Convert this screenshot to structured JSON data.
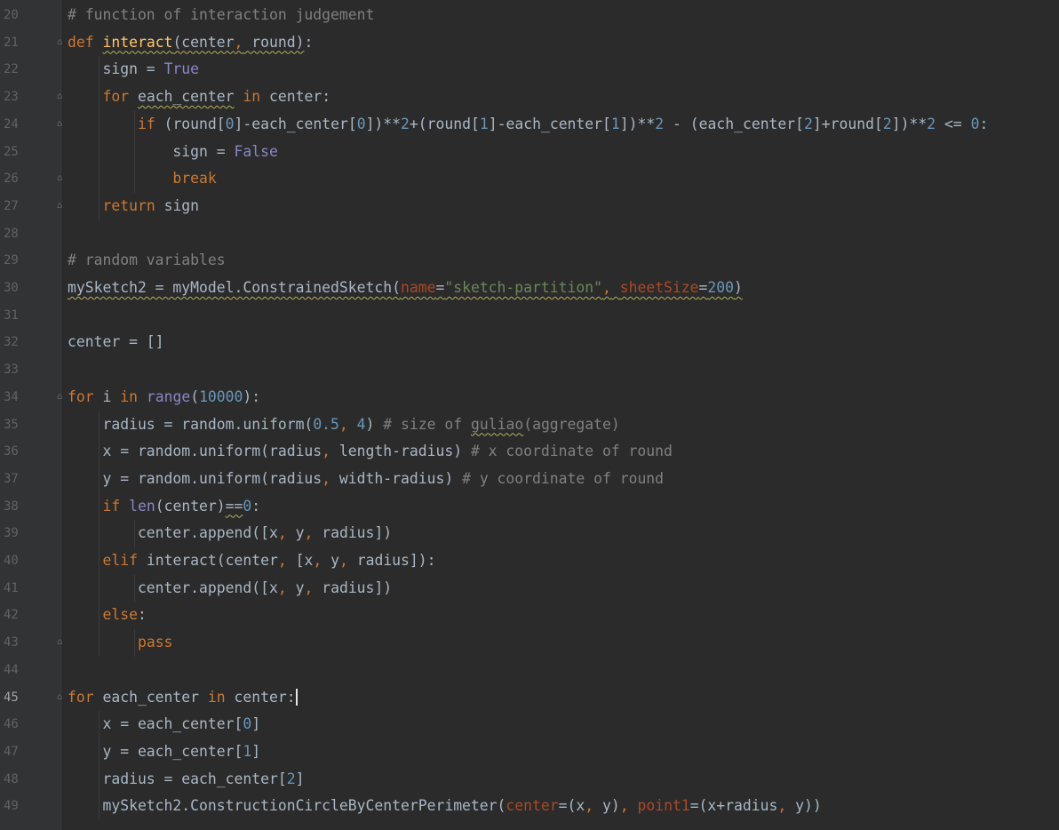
{
  "editor": {
    "language": "python",
    "current_line": 45,
    "colors": {
      "background": "#2b2b2b",
      "gutter": "#313335",
      "keyword": "#cc7832",
      "function": "#ffc66d",
      "string": "#6a8759",
      "number": "#6897bb",
      "comment": "#808080",
      "builtin": "#8888c6",
      "param": "#aa4926",
      "text": "#a9b7c6"
    },
    "lines": [
      {
        "n": "20",
        "text": "# function of interaction judgement"
      },
      {
        "n": "21",
        "text": "def interact(center, round):"
      },
      {
        "n": "22",
        "text": "    sign = True"
      },
      {
        "n": "23",
        "text": "    for each_center in center:"
      },
      {
        "n": "24",
        "text": "        if (round[0]-each_center[0])**2+(round[1]-each_center[1])**2 - (each_center[2]+round[2])**2 <= 0:"
      },
      {
        "n": "25",
        "text": "            sign = False"
      },
      {
        "n": "26",
        "text": "            break"
      },
      {
        "n": "27",
        "text": "    return sign"
      },
      {
        "n": "28",
        "text": ""
      },
      {
        "n": "29",
        "text": "# random variables"
      },
      {
        "n": "30",
        "text": "mySketch2 = myModel.ConstrainedSketch(name=\"sketch-partition\", sheetSize=200)"
      },
      {
        "n": "31",
        "text": ""
      },
      {
        "n": "32",
        "text": "center = []"
      },
      {
        "n": "33",
        "text": ""
      },
      {
        "n": "34",
        "text": "for i in range(10000):"
      },
      {
        "n": "35",
        "text": "    radius = random.uniform(0.5, 4) # size of guliao(aggregate)"
      },
      {
        "n": "36",
        "text": "    x = random.uniform(radius, length-radius) # x coordinate of round"
      },
      {
        "n": "37",
        "text": "    y = random.uniform(radius, width-radius) # y coordinate of round"
      },
      {
        "n": "38",
        "text": "    if len(center)==0:"
      },
      {
        "n": "39",
        "text": "        center.append([x, y, radius])"
      },
      {
        "n": "40",
        "text": "    elif interact(center, [x, y, radius]):"
      },
      {
        "n": "41",
        "text": "        center.append([x, y, radius])"
      },
      {
        "n": "42",
        "text": "    else:"
      },
      {
        "n": "43",
        "text": "        pass"
      },
      {
        "n": "44",
        "text": ""
      },
      {
        "n": "45",
        "text": "for each_center in center:"
      },
      {
        "n": "46",
        "text": "    x = each_center[0]"
      },
      {
        "n": "47",
        "text": "    y = each_center[1]"
      },
      {
        "n": "48",
        "text": "    radius = each_center[2]"
      },
      {
        "n": "49",
        "text": "    mySketch2.ConstructionCircleByCenterPerimeter(center=(x, y), point1=(x+radius, y))"
      }
    ]
  }
}
